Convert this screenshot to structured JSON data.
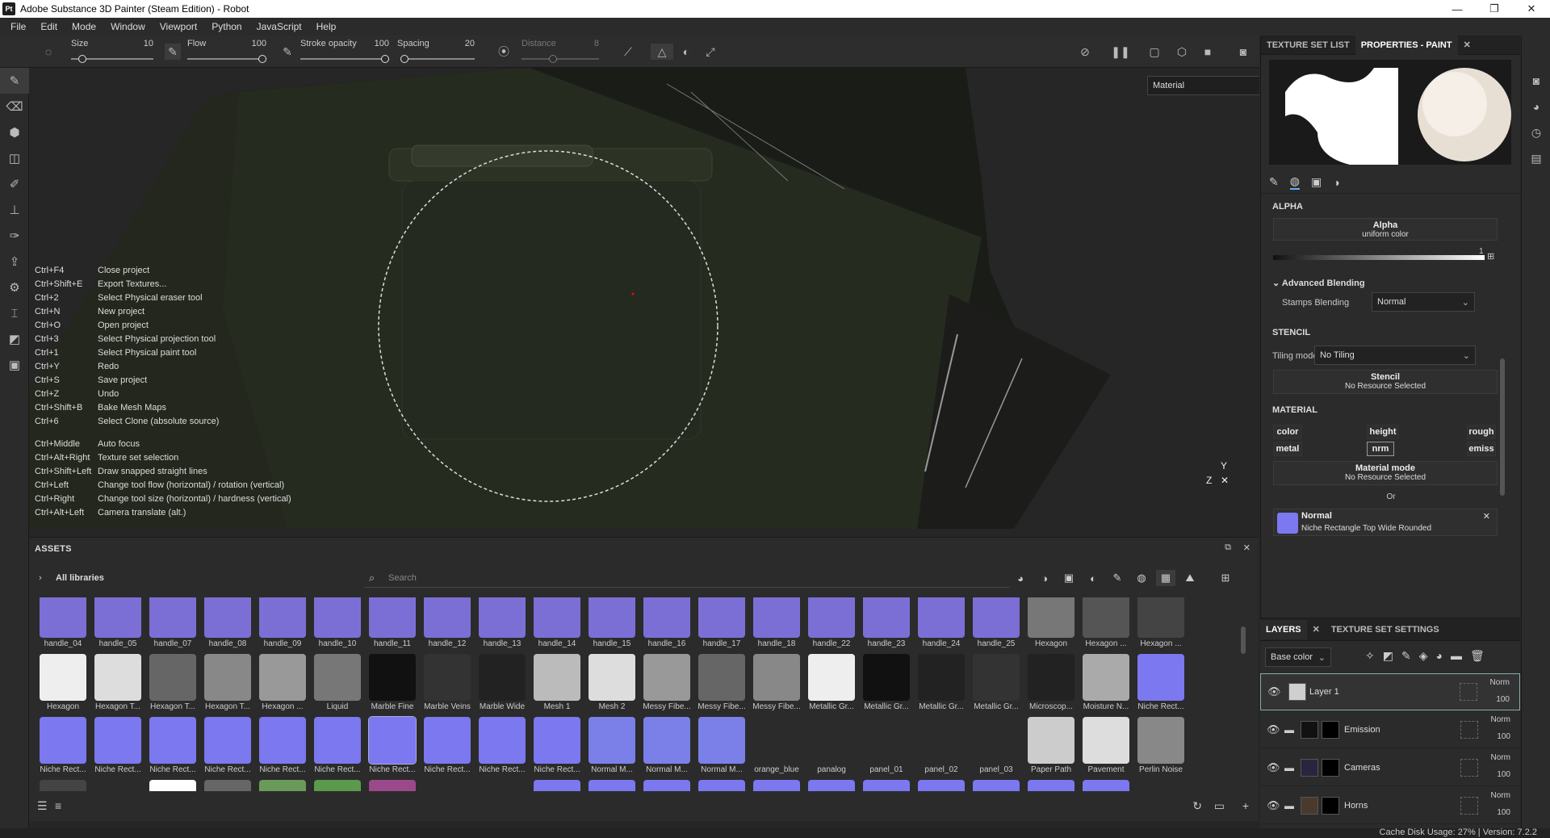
{
  "window": {
    "title": "Adobe Substance 3D Painter (Steam Edition) - Robot",
    "app_icon": "Pt",
    "controls": [
      "—",
      "❐",
      "✕"
    ]
  },
  "menu": [
    "File",
    "Edit",
    "Mode",
    "Window",
    "Viewport",
    "Python",
    "JavaScript",
    "Help"
  ],
  "toolbar": {
    "size_label": "Size",
    "size_value": "10",
    "size_fill": 0.1,
    "flow_label": "Flow",
    "flow_value": "100",
    "flow_fill": 1.0,
    "stroke_opacity_label": "Stroke opacity",
    "stroke_opacity_value": "100",
    "stroke_opacity_fill": 1.0,
    "spacing_label": "Spacing",
    "spacing_value": "20",
    "spacing_fill": 0.0,
    "distance_label": "Distance",
    "distance_value": "8",
    "distance_fill": 0.4
  },
  "viewport": {
    "channel_select": "Material",
    "shortcuts": [
      [
        "Ctrl+F4",
        "Close project"
      ],
      [
        "Ctrl+Shift+E",
        "Export Textures..."
      ],
      [
        "Ctrl+2",
        "Select Physical eraser tool"
      ],
      [
        "Ctrl+N",
        "New project"
      ],
      [
        "Ctrl+O",
        "Open project"
      ],
      [
        "Ctrl+3",
        "Select Physical projection tool"
      ],
      [
        "Ctrl+1",
        "Select Physical paint tool"
      ],
      [
        "Ctrl+Y",
        "Redo"
      ],
      [
        "Ctrl+S",
        "Save project"
      ],
      [
        "Ctrl+Z",
        "Undo"
      ],
      [
        "Ctrl+Shift+B",
        "Bake Mesh Maps"
      ],
      [
        "Ctrl+6",
        "Select Clone (absolute source)"
      ]
    ],
    "shortcuts2": [
      [
        "Ctrl+Middle",
        "Auto focus"
      ],
      [
        "Ctrl+Alt+Right",
        "Texture set selection"
      ],
      [
        "Ctrl+Shift+Left",
        "Draw snapped straight lines"
      ],
      [
        "Ctrl+Left",
        "Change tool flow (horizontal) / rotation (vertical)"
      ],
      [
        "Ctrl+Right",
        "Change tool size (horizontal) / hardness (vertical)"
      ],
      [
        "Ctrl+Alt+Left",
        "Camera translate (alt.)"
      ]
    ],
    "axis_y": "Y",
    "axis_z": "Z"
  },
  "assets": {
    "title": "ASSETS",
    "libraries": "All libraries",
    "search_placeholder": "Search",
    "items": [
      {
        "label": "handle_04",
        "color": "#7b6fd6"
      },
      {
        "label": "handle_05",
        "color": "#7b6fd6"
      },
      {
        "label": "handle_07",
        "color": "#7b6fd6"
      },
      {
        "label": "handle_08",
        "color": "#7b6fd6"
      },
      {
        "label": "handle_09",
        "color": "#7b6fd6"
      },
      {
        "label": "handle_10",
        "color": "#7b6fd6"
      },
      {
        "label": "handle_11",
        "color": "#7b6fd6"
      },
      {
        "label": "handle_12",
        "color": "#7b6fd6"
      },
      {
        "label": "handle_13",
        "color": "#7b6fd6"
      },
      {
        "label": "handle_14",
        "color": "#7b6fd6"
      },
      {
        "label": "handle_15",
        "color": "#7b6fd6"
      },
      {
        "label": "handle_16",
        "color": "#7b6fd6"
      },
      {
        "label": "handle_17",
        "color": "#7b6fd6"
      },
      {
        "label": "handle_18",
        "color": "#7b6fd6"
      },
      {
        "label": "handle_22",
        "color": "#7b6fd6"
      },
      {
        "label": "handle_23",
        "color": "#7b6fd6"
      },
      {
        "label": "handle_24",
        "color": "#7b6fd6"
      },
      {
        "label": "handle_25",
        "color": "#7b6fd6"
      },
      {
        "label": "Hexagon",
        "color": "#777"
      },
      {
        "label": "Hexagon ...",
        "color": "#555"
      },
      {
        "label": "Hexagon ...",
        "color": "#444"
      },
      {
        "label": "Hexagon",
        "color": "#eee"
      },
      {
        "label": "Hexagon T...",
        "color": "#ddd"
      },
      {
        "label": "Hexagon T...",
        "color": "#666"
      },
      {
        "label": "Hexagon T...",
        "color": "#888"
      },
      {
        "label": "Hexagon ...",
        "color": "#999"
      },
      {
        "label": "Liquid",
        "color": "#777"
      },
      {
        "label": "Marble Fine",
        "color": "#111"
      },
      {
        "label": "Marble Veins",
        "color": "#333"
      },
      {
        "label": "Marble Wide",
        "color": "#222"
      },
      {
        "label": "Mesh 1",
        "color": "#bbb"
      },
      {
        "label": "Mesh 2",
        "color": "#ddd"
      },
      {
        "label": "Messy Fibe...",
        "color": "#999"
      },
      {
        "label": "Messy Fibe...",
        "color": "#666"
      },
      {
        "label": "Messy Fibe...",
        "color": "#888"
      },
      {
        "label": "Metallic Gr...",
        "color": "#eee"
      },
      {
        "label": "Metallic Gr...",
        "color": "#111"
      },
      {
        "label": "Metallic Gr...",
        "color": "#222"
      },
      {
        "label": "Metallic Gr...",
        "color": "#333"
      },
      {
        "label": "Microscop...",
        "color": "#222"
      },
      {
        "label": "Moisture N...",
        "color": "#aaa"
      },
      {
        "label": "Niche Rect...",
        "color": "#7b78f0"
      },
      {
        "label": "Niche Rect...",
        "color": "#7b78f0"
      },
      {
        "label": "Niche Rect...",
        "color": "#7b78f0"
      },
      {
        "label": "Niche Rect...",
        "color": "#7b78f0"
      },
      {
        "label": "Niche Rect...",
        "color": "#7b78f0"
      },
      {
        "label": "Niche Rect...",
        "color": "#7b78f0"
      },
      {
        "label": "Niche Rect...",
        "color": "#7b78f0"
      },
      {
        "label": "Niche Rect...",
        "color": "#7b78f0"
      },
      {
        "label": "Niche Rect...",
        "color": "#7b78f0"
      },
      {
        "label": "Niche Rect...",
        "color": "#7b78f0"
      },
      {
        "label": "Niche Rect...",
        "color": "#7b78f0"
      },
      {
        "label": "Normal M...",
        "color": "#7a80e8"
      },
      {
        "label": "Normal M...",
        "color": "#7a80e8"
      },
      {
        "label": "Normal M...",
        "color": "#7a80e8"
      },
      {
        "label": "orange_blue",
        "color": "#2b2b2b"
      },
      {
        "label": "panalog",
        "color": "#2b2b2b"
      },
      {
        "label": "panel_01",
        "color": "#2b2b2b"
      },
      {
        "label": "panel_02",
        "color": "#2b2b2b"
      },
      {
        "label": "panel_03",
        "color": "#2b2b2b"
      },
      {
        "label": "Paper Path",
        "color": "#ccc"
      },
      {
        "label": "Pavement",
        "color": "#ddd"
      },
      {
        "label": "Perlin Noise",
        "color": "#888"
      },
      {
        "label": "",
        "color": "#444"
      },
      {
        "label": "",
        "color": "#2b2b2b"
      },
      {
        "label": "",
        "color": "#fff"
      },
      {
        "label": "",
        "color": "#666"
      },
      {
        "label": "",
        "color": "#6a9a5a"
      },
      {
        "label": "",
        "color": "#5a9a4a"
      },
      {
        "label": "",
        "color": "#9a4a8a"
      },
      {
        "label": "",
        "color": "#2b2b2b"
      },
      {
        "label": "",
        "color": "#2b2b2b"
      },
      {
        "label": "",
        "color": "#7b78f0"
      },
      {
        "label": "",
        "color": "#7b78f0"
      },
      {
        "label": "",
        "color": "#7b78f0"
      },
      {
        "label": "",
        "color": "#7b78f0"
      },
      {
        "label": "",
        "color": "#7b78f0"
      },
      {
        "label": "",
        "color": "#7b78f0"
      },
      {
        "label": "",
        "color": "#7b78f0"
      },
      {
        "label": "",
        "color": "#7b78f0"
      },
      {
        "label": "",
        "color": "#7b78f0"
      },
      {
        "label": "",
        "color": "#7b78f0"
      },
      {
        "label": "",
        "color": "#7b78f0"
      }
    ],
    "selected_label": "Niche Rect..."
  },
  "properties": {
    "tab_texture_set": "TEXTURE SET LIST",
    "tab_properties": "PROPERTIES - PAINT",
    "alpha_section": "ALPHA",
    "alpha_box_title": "Alpha",
    "alpha_box_sub": "uniform color",
    "alpha_value": "1",
    "advanced_blending": "Advanced Blending",
    "stamps_blending_label": "Stamps Blending",
    "stamps_blending_value": "Normal",
    "stencil_section": "STENCIL",
    "tiling_mode_label": "Tiling mode",
    "tiling_mode_value": "No Tiling",
    "stencil_box_title": "Stencil",
    "stencil_box_sub": "No Resource Selected",
    "material_section": "MATERIAL",
    "mat_color": "color",
    "mat_height": "height",
    "mat_rough": "rough",
    "mat_metal": "metal",
    "mat_nrm": "nrm",
    "mat_emiss": "emiss",
    "material_mode_title": "Material mode",
    "material_mode_sub": "No Resource Selected",
    "or_label": "Or",
    "normal_title": "Normal",
    "normal_sub": "Niche Rectangle Top Wide Rounded"
  },
  "layers": {
    "tab_layers": "LAYERS",
    "tab_texture_set_settings": "TEXTURE SET SETTINGS",
    "channel": "Base color",
    "rows": [
      {
        "name": "Layer 1",
        "blend": "Norm",
        "opacity": "100",
        "thumb": "#cfcfcf"
      },
      {
        "name": "Emission",
        "blend": "Norm",
        "opacity": "100",
        "thumb": "#111"
      },
      {
        "name": "Cameras",
        "blend": "Norm",
        "opacity": "100",
        "thumb": "#2a2440"
      },
      {
        "name": "Horns",
        "blend": "Norm",
        "opacity": "100",
        "thumb": "#4a3a2e"
      }
    ]
  },
  "status": {
    "text": "Cache Disk Usage:  27% | Version: 7.2.2"
  }
}
